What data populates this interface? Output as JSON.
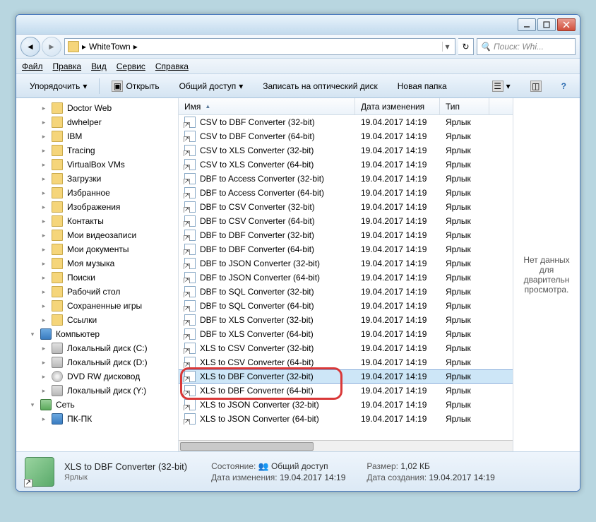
{
  "address": {
    "path": "WhiteTown"
  },
  "search": {
    "placeholder": "Поиск: Whi..."
  },
  "menu": {
    "file": "Файл",
    "edit": "Правка",
    "view": "Вид",
    "tools": "Сервис",
    "help": "Справка"
  },
  "toolbar": {
    "organize": "Упорядочить",
    "open": "Открыть",
    "share": "Общий доступ",
    "burn": "Записать на оптический диск",
    "newfolder": "Новая папка"
  },
  "tree": [
    {
      "label": "Doctor Web",
      "icon": "folder",
      "ind": 1
    },
    {
      "label": "dwhelper",
      "icon": "folder",
      "ind": 1
    },
    {
      "label": "IBM",
      "icon": "folder",
      "ind": 1
    },
    {
      "label": "Tracing",
      "icon": "folder",
      "ind": 1
    },
    {
      "label": "VirtualBox VMs",
      "icon": "folder",
      "ind": 1
    },
    {
      "label": "Загрузки",
      "icon": "folder",
      "ind": 1
    },
    {
      "label": "Избранное",
      "icon": "folder",
      "ind": 1
    },
    {
      "label": "Изображения",
      "icon": "folder",
      "ind": 1
    },
    {
      "label": "Контакты",
      "icon": "folder",
      "ind": 1
    },
    {
      "label": "Мои видеозаписи",
      "icon": "folder",
      "ind": 1
    },
    {
      "label": "Мои документы",
      "icon": "folder",
      "ind": 1
    },
    {
      "label": "Моя музыка",
      "icon": "folder",
      "ind": 1
    },
    {
      "label": "Поиски",
      "icon": "folder",
      "ind": 1
    },
    {
      "label": "Рабочий стол",
      "icon": "folder",
      "ind": 1
    },
    {
      "label": "Сохраненные игры",
      "icon": "folder",
      "ind": 1
    },
    {
      "label": "Ссылки",
      "icon": "folder",
      "ind": 1
    },
    {
      "label": "Компьютер",
      "icon": "computer",
      "ind": 0,
      "exp": "▾"
    },
    {
      "label": "Локальный диск (C:)",
      "icon": "drive",
      "ind": 1
    },
    {
      "label": "Локальный диск (D:)",
      "icon": "drive",
      "ind": 1
    },
    {
      "label": "DVD RW дисковод",
      "icon": "dvd",
      "ind": 1
    },
    {
      "label": "Локальный диск (Y:)",
      "icon": "drive",
      "ind": 1
    },
    {
      "label": "Сеть",
      "icon": "network",
      "ind": 0,
      "exp": "▾"
    },
    {
      "label": "ПК-ПК",
      "icon": "computer",
      "ind": 1
    }
  ],
  "columns": {
    "name": "Имя",
    "date": "Дата изменения",
    "type": "Тип"
  },
  "files": [
    {
      "name": "CSV to DBF Converter (32-bit)",
      "date": "19.04.2017 14:19",
      "type": "Ярлык"
    },
    {
      "name": "CSV to DBF Converter (64-bit)",
      "date": "19.04.2017 14:19",
      "type": "Ярлык"
    },
    {
      "name": "CSV to XLS Converter (32-bit)",
      "date": "19.04.2017 14:19",
      "type": "Ярлык"
    },
    {
      "name": "CSV to XLS Converter (64-bit)",
      "date": "19.04.2017 14:19",
      "type": "Ярлык"
    },
    {
      "name": "DBF to Access Converter (32-bit)",
      "date": "19.04.2017 14:19",
      "type": "Ярлык"
    },
    {
      "name": "DBF to Access Converter (64-bit)",
      "date": "19.04.2017 14:19",
      "type": "Ярлык"
    },
    {
      "name": "DBF to CSV Converter (32-bit)",
      "date": "19.04.2017 14:19",
      "type": "Ярлык"
    },
    {
      "name": "DBF to CSV Converter (64-bit)",
      "date": "19.04.2017 14:19",
      "type": "Ярлык"
    },
    {
      "name": "DBF to DBF Converter (32-bit)",
      "date": "19.04.2017 14:19",
      "type": "Ярлык"
    },
    {
      "name": "DBF to DBF Converter (64-bit)",
      "date": "19.04.2017 14:19",
      "type": "Ярлык"
    },
    {
      "name": "DBF to JSON Converter (32-bit)",
      "date": "19.04.2017 14:19",
      "type": "Ярлык"
    },
    {
      "name": "DBF to JSON Converter (64-bit)",
      "date": "19.04.2017 14:19",
      "type": "Ярлык"
    },
    {
      "name": "DBF to SQL Converter (32-bit)",
      "date": "19.04.2017 14:19",
      "type": "Ярлык"
    },
    {
      "name": "DBF to SQL Converter (64-bit)",
      "date": "19.04.2017 14:19",
      "type": "Ярлык"
    },
    {
      "name": "DBF to XLS Converter (32-bit)",
      "date": "19.04.2017 14:19",
      "type": "Ярлык"
    },
    {
      "name": "DBF to XLS Converter (64-bit)",
      "date": "19.04.2017 14:19",
      "type": "Ярлык"
    },
    {
      "name": "XLS to CSV Converter (32-bit)",
      "date": "19.04.2017 14:19",
      "type": "Ярлык"
    },
    {
      "name": "XLS to CSV Converter (64-bit)",
      "date": "19.04.2017 14:19",
      "type": "Ярлык"
    },
    {
      "name": "XLS to DBF Converter (32-bit)",
      "date": "19.04.2017 14:19",
      "type": "Ярлык",
      "sel": true
    },
    {
      "name": "XLS to DBF Converter (64-bit)",
      "date": "19.04.2017 14:19",
      "type": "Ярлык"
    },
    {
      "name": "XLS to JSON Converter (32-bit)",
      "date": "19.04.2017 14:19",
      "type": "Ярлык"
    },
    {
      "name": "XLS to JSON Converter (64-bit)",
      "date": "19.04.2017 14:19",
      "type": "Ярлык"
    }
  ],
  "preview": {
    "text": "Нет данных для дварительн просмотра."
  },
  "status": {
    "title": "XLS to DBF Converter (32-bit)",
    "subtitle": "Ярлык",
    "state_label": "Состояние:",
    "state": "Общий доступ",
    "modified_label": "Дата изменения:",
    "modified": "19.04.2017 14:19",
    "size_label": "Размер:",
    "size": "1,02 КБ",
    "created_label": "Дата создания:",
    "created": "19.04.2017 14:19"
  }
}
